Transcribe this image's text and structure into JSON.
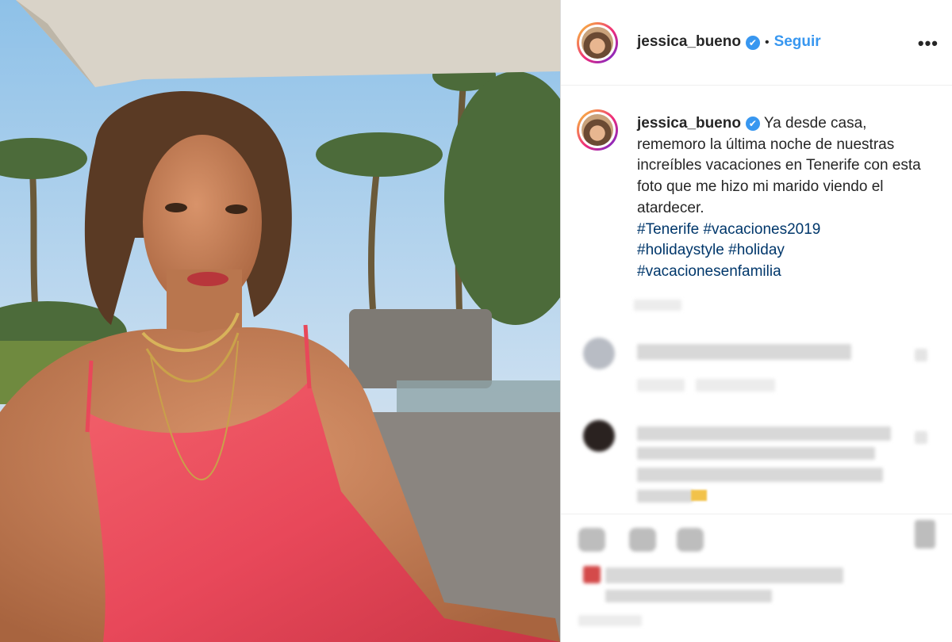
{
  "header": {
    "username": "jessica_bueno",
    "verified_icon": "✔",
    "separator": "•",
    "follow_label": "Seguir",
    "more_label": "•••"
  },
  "caption": {
    "username": "jessica_bueno",
    "verified_icon": "✔",
    "text": " Ya desde casa, rememoro la última noche de nuestras increíbles vacaciones en Tenerife con esta foto que me hizo mi marido viendo el atardecer.",
    "hashtags": [
      "#Tenerife",
      "#vacaciones2019",
      "#holidaystyle",
      "#holiday",
      "#vacacionesenfamilia"
    ]
  },
  "colors": {
    "link_blue": "#3897f0",
    "hashtag_blue": "#00376b",
    "text": "#262626",
    "dress": "#e8485a"
  }
}
